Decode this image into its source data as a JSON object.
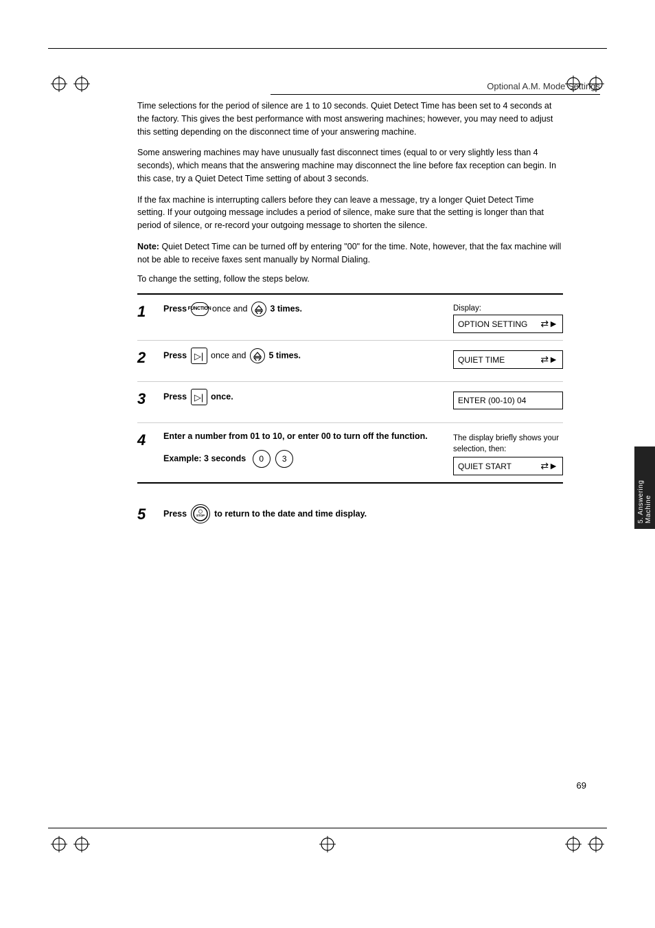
{
  "page": {
    "header": "Optional A.M. Mode Settings",
    "page_number": "69",
    "side_tab": "5. Answering Machine"
  },
  "paragraphs": [
    "Time selections for the period of silence are 1 to 10 seconds. Quiet Detect Time has been set to 4 seconds at the factory. This gives the best performance with most answering machines; however, you may need to adjust this setting depending on the disconnect time of your answering machine.",
    "Some answering machines may have unusually fast disconnect times (equal to or very slightly less than 4 seconds), which means that the answering machine may disconnect the line before fax reception can begin. In this case, try a Quiet Detect Time setting of about 3 seconds.",
    "If the fax machine is interrupting callers before they can leave a message, try a longer Quiet Detect Time setting. If your outgoing message includes a period of silence, make sure that the setting is longer than that period of silence, or re-record your outgoing message to shorten the silence.",
    "Quiet Detect Time can be turned off by entering \"00\" for the time. Note, however, that the fax machine will not be able to receive faxes sent manually by Normal Dialing.",
    "To change the setting, follow the steps below."
  ],
  "note_label": "Note:",
  "steps": [
    {
      "num": "1",
      "text": "Press",
      "button1_label": "FUNCTION",
      "middle_text": " once and ",
      "button2_label": "▲▼",
      "end_text": " 3 times.",
      "display_label": "Display:",
      "display_text": "OPTION SETTING",
      "display_arrow": "⬧▶"
    },
    {
      "num": "2",
      "text": "Press",
      "button1_label": "▶|",
      "middle_text": " once and ",
      "button2_label": "▲▼",
      "end_text": " 5 times.",
      "display_label": "",
      "display_text": "QUIET TIME",
      "display_arrow": "⬧▶"
    },
    {
      "num": "3",
      "text": "Press",
      "button1_label": "▶|",
      "middle_text": " once.",
      "button2_label": "",
      "end_text": "",
      "display_label": "",
      "display_text": "ENTER (00-10) 04",
      "display_arrow": ""
    },
    {
      "num": "4",
      "text": "Enter a number from 01 to 10, or enter 00 to turn off the function.",
      "example_text": "Example: 3 seconds",
      "example_keys": [
        "0",
        "3"
      ],
      "display_note": "The display briefly shows your selection, then:",
      "display_text": "QUIET START",
      "display_arrow": "⬧▶"
    }
  ],
  "step5": {
    "num": "5",
    "text": "Press",
    "button_label": "STOP",
    "end_text": " to return to the date and time display."
  }
}
